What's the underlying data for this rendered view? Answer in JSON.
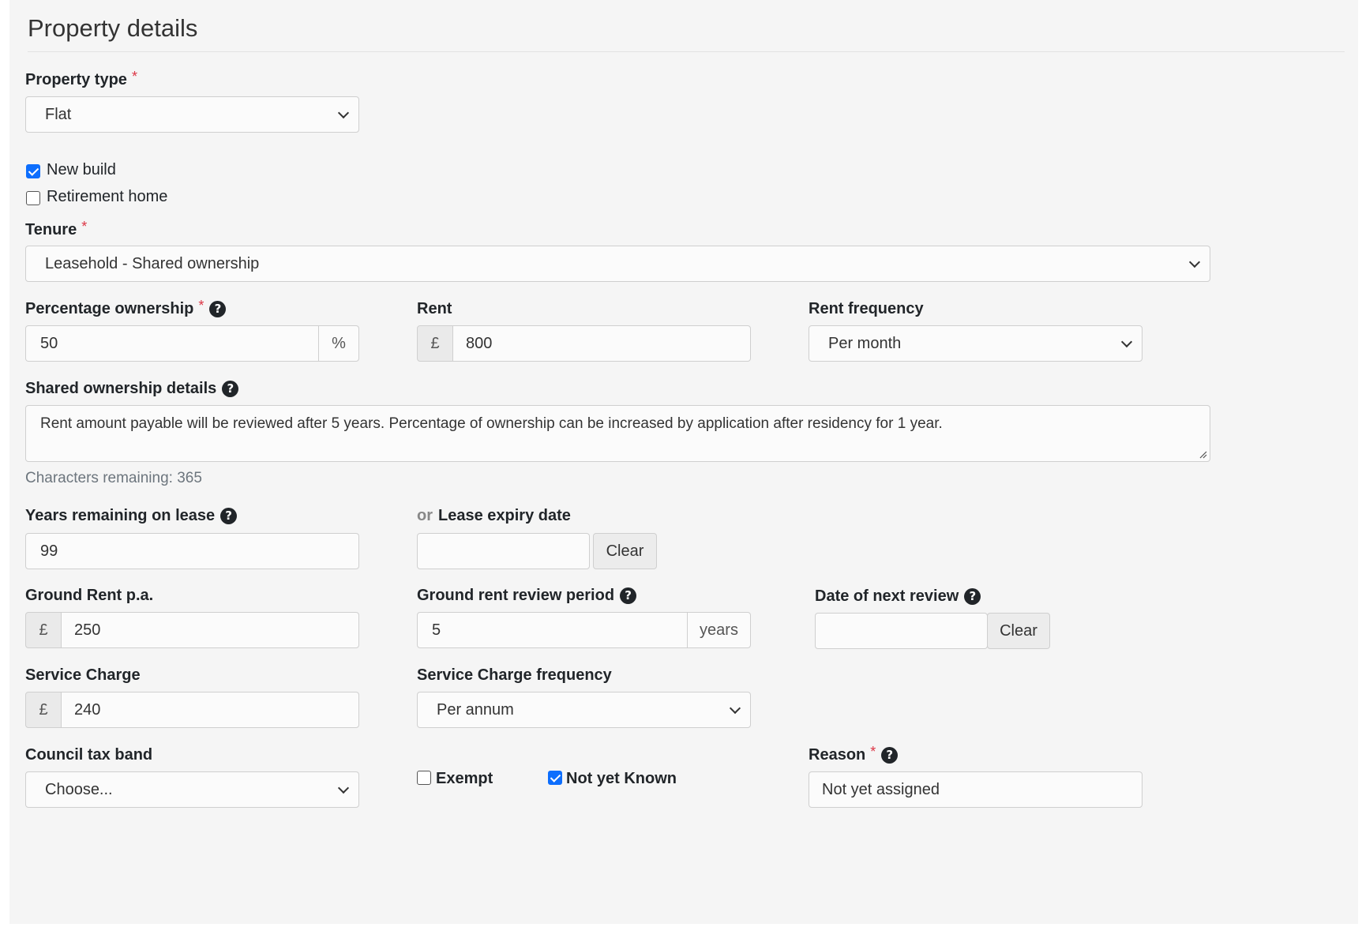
{
  "section": {
    "title": "Property details"
  },
  "property_type": {
    "label": "Property type",
    "required_mark": "*",
    "value": "Flat"
  },
  "new_build": {
    "label": "New build",
    "checked": true
  },
  "retirement_home": {
    "label": "Retirement home",
    "checked": false
  },
  "tenure": {
    "label": "Tenure",
    "required_mark": "*",
    "value": "Leasehold - Shared ownership"
  },
  "percentage_ownership": {
    "label": "Percentage ownership",
    "required_mark": "*",
    "value": "50",
    "suffix": "%"
  },
  "rent": {
    "label": "Rent",
    "prefix": "£",
    "value": "800"
  },
  "rent_frequency": {
    "label": "Rent frequency",
    "value": "Per month"
  },
  "shared_ownership_details": {
    "label": "Shared ownership details",
    "value": "Rent amount payable will be reviewed after 5 years. Percentage of ownership can be increased by application after residency for 1 year.",
    "chars_remaining": "Characters remaining: 365"
  },
  "years_remaining": {
    "label": "Years remaining on lease",
    "value": "99"
  },
  "lease_expiry": {
    "or_text": "or",
    "label": "Lease expiry date",
    "value": "",
    "clear_label": "Clear"
  },
  "ground_rent": {
    "label": "Ground Rent p.a.",
    "prefix": "£",
    "value": "250"
  },
  "ground_rent_review": {
    "label": "Ground rent review period",
    "value": "5",
    "suffix": "years"
  },
  "next_review": {
    "label": "Date of next review",
    "value": "",
    "clear_label": "Clear"
  },
  "service_charge": {
    "label": "Service Charge",
    "prefix": "£",
    "value": "240"
  },
  "service_charge_frequency": {
    "label": "Service Charge frequency",
    "value": "Per annum"
  },
  "council_tax_band": {
    "label": "Council tax band",
    "value": "Choose..."
  },
  "exempt": {
    "label": "Exempt",
    "checked": false
  },
  "not_yet_known": {
    "label": "Not yet Known",
    "checked": true
  },
  "reason": {
    "label": "Reason",
    "required_mark": "*",
    "value": "Not yet assigned"
  },
  "icons": {
    "help": "question-circle-icon",
    "dropdown": "chevron-down-icon",
    "resize": "resize-grip-icon"
  },
  "colors": {
    "accent": "#0d6efd",
    "required": "#dc3545",
    "panel_bg": "#f5f5f5"
  }
}
